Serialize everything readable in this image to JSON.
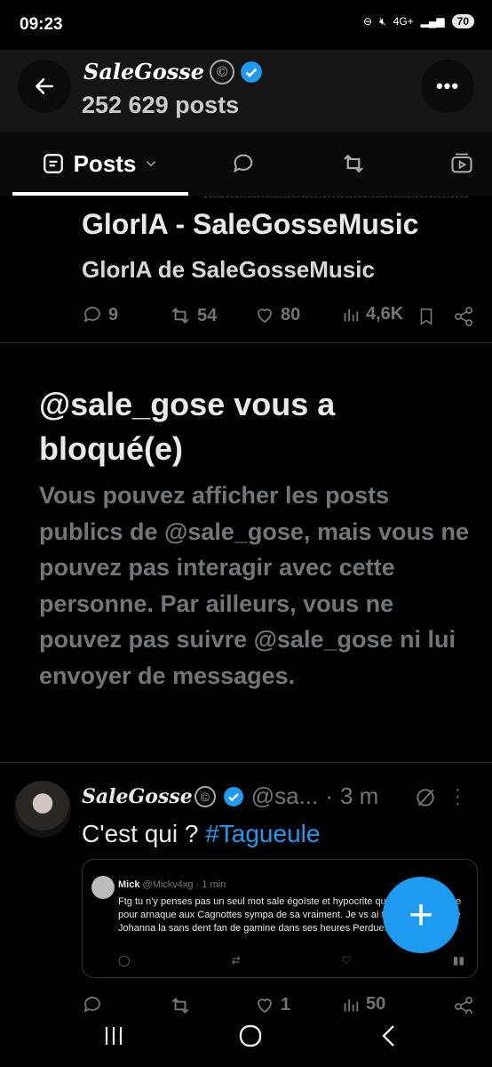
{
  "status_bar": {
    "time": "09:23",
    "network": "4G+",
    "battery": "70"
  },
  "header": {
    "profile_name": "SaleGosse",
    "copyright_mark": "©",
    "post_count": "252 629 posts"
  },
  "tabs": [
    {
      "label": "Posts",
      "active": true
    }
  ],
  "tweet1": {
    "title": "GlorIA - SaleGosseMusic",
    "subtitle": "GlorIA de SaleGosseMusic",
    "replies": "9",
    "retweets": "54",
    "likes": "80",
    "views": "4,6K"
  },
  "block_notice": {
    "title": "@sale_gose vous a bloqué(e)",
    "body": "Vous pouvez afficher les posts publics de @sale_gose, mais vous ne pouvez pas interagir avec cette personne. Par ailleurs, vous ne pouvez pas suivre @sale_gose ni lui envoyer de messages."
  },
  "tweet2": {
    "name": "SaleGosse",
    "copyright_mark": "©",
    "handle": "@sa...",
    "separator": "·",
    "time": "3 m",
    "text_prefix": "C'est qui ? ",
    "hashtag": "#Tagueule",
    "quote": {
      "name": "Mick",
      "handle": "@Mickv4xg",
      "time": "· 1 min",
      "text": "Ftg tu n'y penses pas un seul mot sale égoïste et hypocrite qui devant la justice pour arnaque aux Cagnottes sympa de sa vraiment. Je vs ai trouver tt ta bande Johanna la sans dent fan de gamine dans ses heures Perdues et les autres."
    },
    "replies": "",
    "likes": "1",
    "views": "50"
  },
  "colors": {
    "accent": "#1d9bf0",
    "muted": "#71767b",
    "text": "#e7e9ea",
    "background": "#000000"
  }
}
